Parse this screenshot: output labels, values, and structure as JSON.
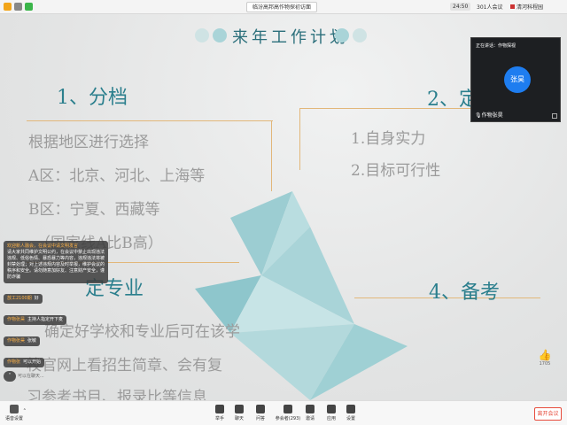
{
  "topbar": {
    "meeting_title": "临汾高邦高作物探初访面",
    "time": "24:50",
    "participants": "301人会议",
    "speaker": "清河科程园"
  },
  "slide": {
    "title": "来年工作计划",
    "sections": [
      {
        "heading": "1、分档",
        "lines": [
          "根据地区进行选择",
          "A区：北京、河北、上海等",
          "B区：宁夏、西藏等",
          "（国家线A比B高）"
        ]
      },
      {
        "heading": "2、定",
        "lines": [
          "1.自身实力",
          "2.目标可行性"
        ]
      },
      {
        "heading": "定专业",
        "lines": [
          "确定好学校和专业后可在该学",
          "校官网上看招生简章、会有复",
          "习参考书目、报录比等信息"
        ]
      },
      {
        "heading": "4、备考",
        "lines": []
      }
    ]
  },
  "video": {
    "label": "正在讲话：作物探视",
    "avatar_text": "张昊",
    "name": "作物张昊"
  },
  "chat": {
    "announcement": {
      "name": "欢迎新人融会，在会议中请文明发言",
      "text": "请大家共同维护文明公约，在会议中禁止出现违法违规、低俗色情、暴恐暴力等内容，违规违法将被封禁处理；对上述违规内容及时举报，维护会议的秩序和安全。请勿随意加好友、注意财产安全，谨防诈骗"
    },
    "items": [
      {
        "name": "放工2100期",
        "text": "好"
      },
      {
        "name": "作物张昊",
        "text": "主持人指定开下麦"
      },
      {
        "name": "作物张昊",
        "text": "张敏"
      },
      {
        "name": "作物张",
        "text": "可以开始"
      }
    ],
    "collapse_icon": "chevron-up-icon",
    "hint": "可以在聊天..."
  },
  "like": {
    "count": "1705"
  },
  "toolbar": {
    "left_label": "语音设置",
    "tools": [
      {
        "icon": "hand-icon",
        "label": "举手"
      },
      {
        "icon": "chat-icon",
        "label": "聊天"
      },
      {
        "icon": "qa-icon",
        "label": "问答"
      },
      {
        "icon": "members-icon",
        "label": "参会者(293)"
      },
      {
        "icon": "invite-icon",
        "label": "邀请"
      },
      {
        "icon": "record-icon",
        "label": "应用"
      },
      {
        "icon": "settings-icon",
        "label": "设置"
      }
    ],
    "leave_label": "离开会议"
  },
  "colors": {
    "accent": "#2b7f8d",
    "gold_line": "#e2b77a",
    "bird_blue": "#a9d4d8",
    "avatar_blue": "#1e7df0",
    "leave_red": "#e74c3c"
  }
}
